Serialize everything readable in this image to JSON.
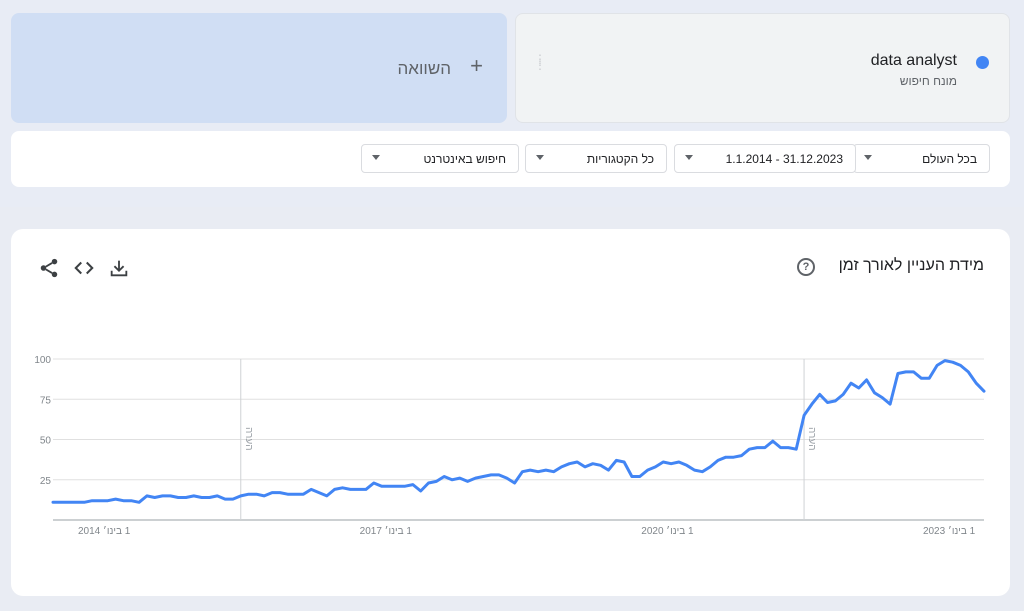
{
  "search_term": {
    "name": "data analyst",
    "subtitle": "מונח חיפוש",
    "color": "#4285f4"
  },
  "compare": {
    "label": "השוואה",
    "plus": "+"
  },
  "filters": {
    "region": "בכל העולם",
    "date_range": "1.1.2014 - 31.12.2023",
    "category": "כל הקטגוריות",
    "search_type": "חיפוש באינטרנט"
  },
  "chart_section": {
    "title": "מידת העניין לאורך זמן",
    "help": "?",
    "icons": [
      "share-icon",
      "embed-icon",
      "download-icon"
    ]
  },
  "chart_data": {
    "type": "line",
    "title": "",
    "xlabel": "",
    "ylabel": "",
    "ylim": [
      0,
      100
    ],
    "yticks": [
      25,
      50,
      75,
      100
    ],
    "grid": true,
    "line_color": "#4285f4",
    "xticks": [
      {
        "x": 2014.0,
        "label": "1 בינו׳ 2014"
      },
      {
        "x": 2017.0,
        "label": "1 בינו׳ 2017"
      },
      {
        "x": 2020.0,
        "label": "1 בינו׳ 2020"
      },
      {
        "x": 2023.0,
        "label": "1 בינו׳ 2023"
      }
    ],
    "annotations": [
      {
        "x": 2016.0,
        "label": "הערה"
      },
      {
        "x": 2022.0,
        "label": "הערה"
      }
    ],
    "series": [
      {
        "values": [
          11,
          11,
          11,
          11,
          11,
          12,
          12,
          12,
          13,
          12,
          12,
          11,
          15,
          14,
          15,
          15,
          14,
          14,
          15,
          14,
          14,
          15,
          13,
          13,
          15,
          16,
          16,
          15,
          17,
          17,
          16,
          16,
          16,
          19,
          17,
          15,
          19,
          20,
          19,
          19,
          19,
          23,
          21,
          21,
          21,
          21,
          22,
          18,
          23,
          24,
          27,
          25,
          26,
          24,
          26,
          27,
          28,
          28,
          26,
          23,
          30,
          31,
          30,
          31,
          30,
          33,
          35,
          36,
          33,
          35,
          34,
          31,
          37,
          36,
          27,
          27,
          31,
          33,
          36,
          35,
          36,
          34,
          31,
          30,
          33,
          37,
          39,
          39,
          40,
          44,
          45,
          45,
          49,
          45,
          45,
          44,
          65,
          72,
          78,
          73,
          74,
          78,
          85,
          82,
          87,
          79,
          76,
          72,
          91,
          92,
          92,
          88,
          88,
          96,
          99,
          98,
          96,
          92,
          85,
          80
        ]
      }
    ]
  }
}
